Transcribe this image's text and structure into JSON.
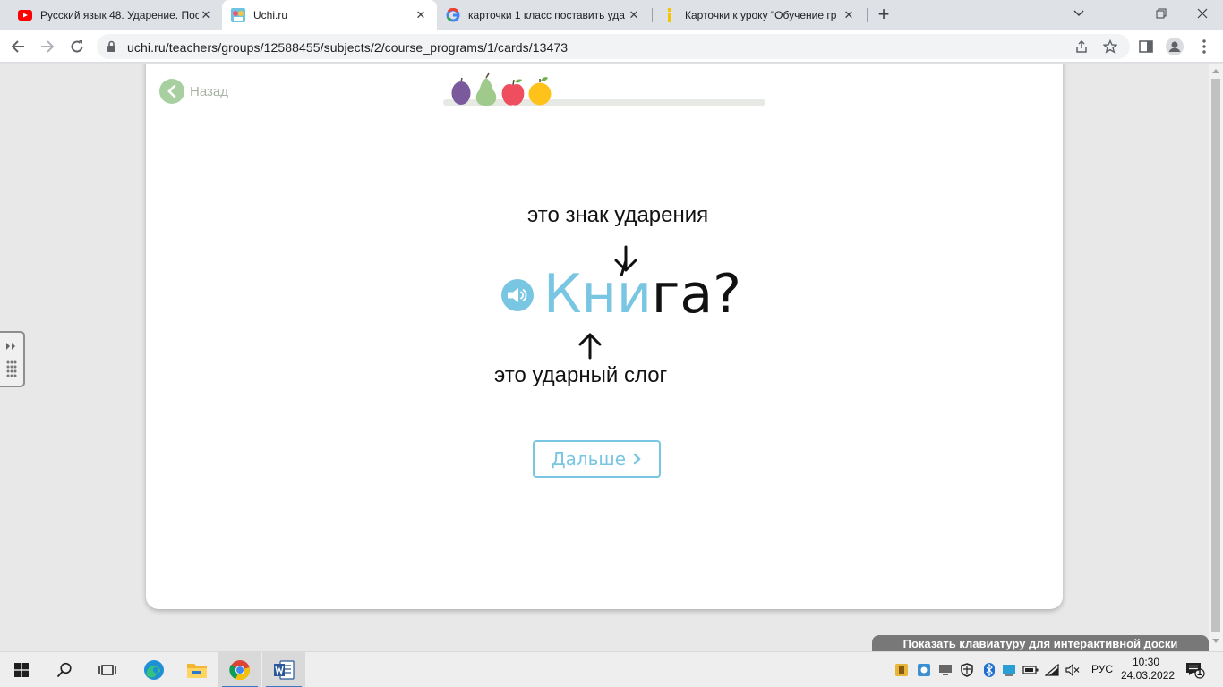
{
  "browser": {
    "tabs": [
      {
        "title": "Русский язык 48. Ударение. Пос",
        "icon": "youtube-icon"
      },
      {
        "title": "Uchi.ru",
        "icon": "uchi-icon",
        "active": true
      },
      {
        "title": "карточки 1 класс поставить уда",
        "icon": "google-icon"
      },
      {
        "title": "Карточки к уроку \"Обучение гр",
        "icon": "yandex-icon"
      }
    ],
    "url": "uchi.ru/teachers/groups/12588455/subjects/2/course_programs/1/cards/13473"
  },
  "card": {
    "back_label": "Назад",
    "stress_label": "это знак ударения",
    "word_stressed": "Кни",
    "word_rest": "га?",
    "syllable_label": "это ударный слог",
    "next_label": "Дальше",
    "accent_color": "#78c6e2"
  },
  "overlay": {
    "keyboard_hint": "Показать клавиатуру для интерактивной доски"
  },
  "taskbar": {
    "language": "РУС",
    "time": "10:30",
    "date": "24.03.2022",
    "notification_count": "1"
  }
}
